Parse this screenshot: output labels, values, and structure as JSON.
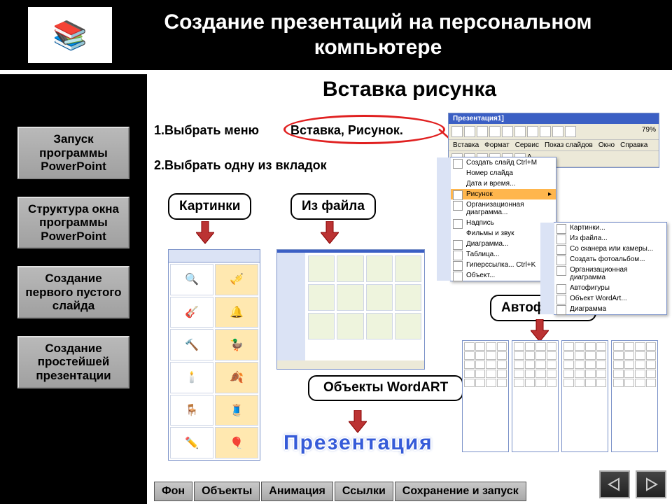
{
  "header": {
    "title": "Создание презентаций на персональном компьютере"
  },
  "sidebar": {
    "items": [
      {
        "label": "Запуск программы PowerPoint"
      },
      {
        "label": "Структура окна программы PowerPoint"
      },
      {
        "label": "Создание первого пустого слайда"
      },
      {
        "label": "Создание простейшей презентации"
      }
    ]
  },
  "slide": {
    "title": "Вставка рисунка",
    "step1a": "1.Выбрать меню",
    "step1b": "Вставка, Рисунок.",
    "step2": "2.Выбрать одну из вкладок",
    "tag_pictures": "Картинки",
    "tag_fromfile": "Из файла",
    "tag_wordart": "Объекты WordART",
    "tag_autoshapes": "Автофигуры",
    "wordart_sample": "Презентация"
  },
  "ppmenu": {
    "titlebar": "Презентация1]",
    "zoom": "79%",
    "menubar": [
      "Вставка",
      "Формат",
      "Сервис",
      "Показ слайдов",
      "Окно",
      "Справка"
    ],
    "items": [
      "Создать слайд        Ctrl+M",
      "Номер слайда",
      "Дата и время...",
      "Рисунок",
      "Организационная диаграмма...",
      "Надпись",
      "Фильмы и звук",
      "Диаграмма...",
      "Таблица...",
      "Гиперссылка...        Ctrl+K",
      "Объект..."
    ],
    "sub": [
      "Картинки...",
      "Из файла...",
      "Со сканера или камеры...",
      "Создать фотоальбом...",
      "Организационная диаграмма",
      "Автофигуры",
      "Объект WordArt...",
      "Диаграмма"
    ]
  },
  "tabs": [
    "Фон",
    "Объекты",
    "Анимация",
    "Ссылки",
    "Сохранение и запуск"
  ]
}
